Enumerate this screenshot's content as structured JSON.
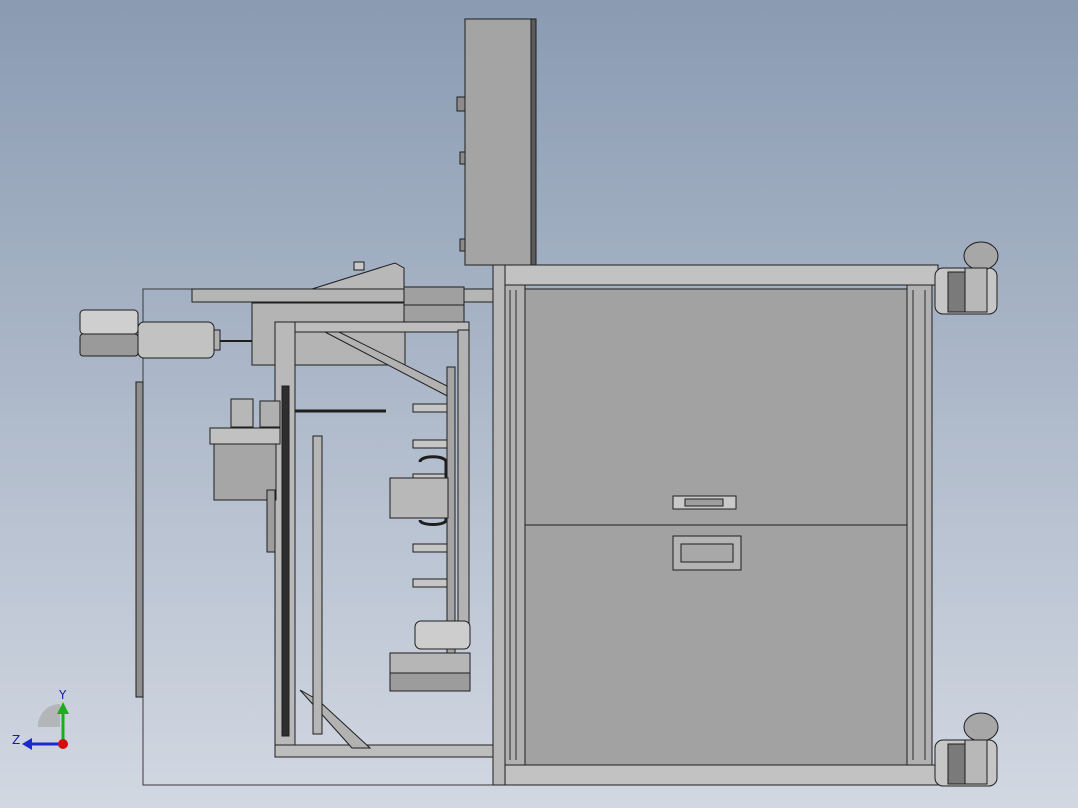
{
  "viewport": {
    "background_top": "#8a9bb2",
    "background_bottom": "#d2d8e2",
    "part_fill": "#a9a9a9",
    "part_fill_light": "#c4c4c4",
    "panel_fill": "#a2a2a2",
    "edge_color": "#1e1e1e"
  },
  "triad": {
    "x_label": "",
    "y_label": "Y",
    "z_label": "Z",
    "y_axis_color": "#1faa1f",
    "z_axis_color": "#1a2ad0",
    "origin_color": "#d01010",
    "icon": "coordinate-triad-icon"
  }
}
